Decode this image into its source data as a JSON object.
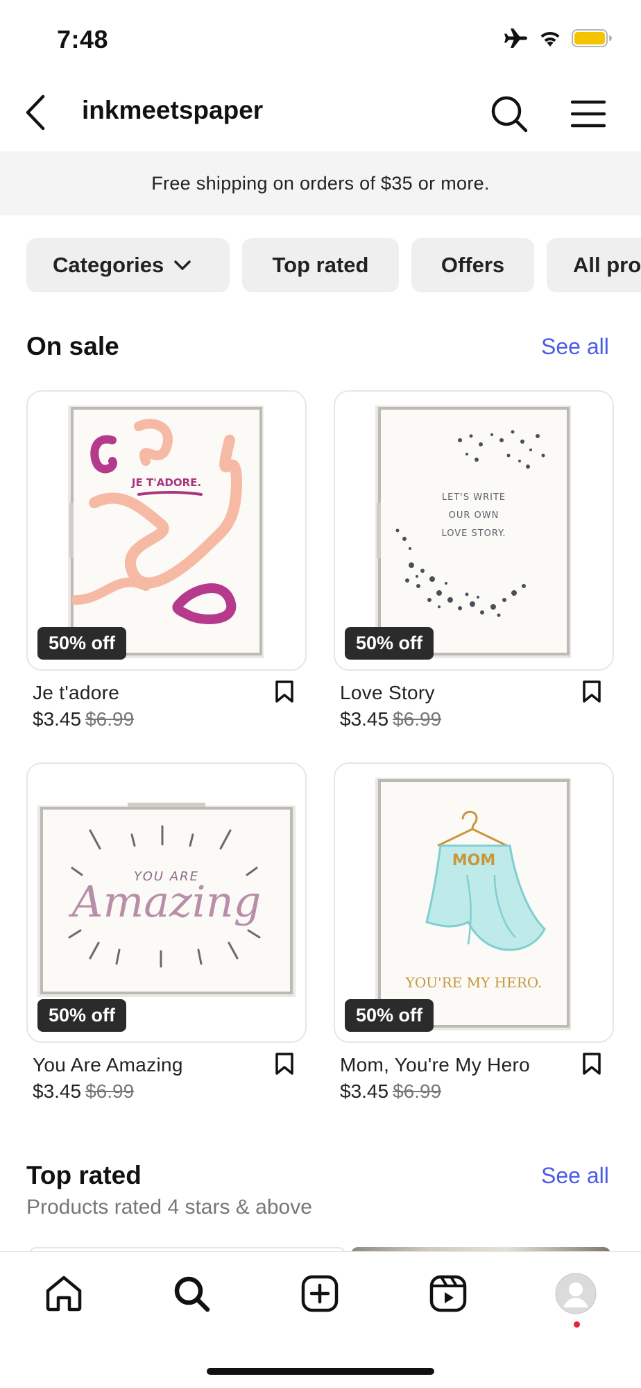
{
  "status_bar": {
    "time": "7:48"
  },
  "header": {
    "title": "inkmeetspaper"
  },
  "banner": {
    "text": "Free shipping on orders of $35 or more."
  },
  "chips": [
    {
      "label": "Categories"
    },
    {
      "label": "Top rated"
    },
    {
      "label": "Offers"
    },
    {
      "label": "All products"
    }
  ],
  "on_sale": {
    "title": "On sale",
    "see_all": "See all",
    "products": [
      {
        "name": "Je t'adore",
        "price": "$3.45",
        "old_price": "$6.99",
        "badge": "50% off",
        "card_text": "JE T'ADORE."
      },
      {
        "name": "Love Story",
        "price": "$3.45",
        "old_price": "$6.99",
        "badge": "50% off",
        "card_text_1": "LET'S WRITE",
        "card_text_2": "OUR OWN",
        "card_text_3": "LOVE STORY."
      },
      {
        "name": "You Are Amazing",
        "price": "$3.45",
        "old_price": "$6.99",
        "badge": "50% off",
        "card_text_1": "YOU ARE",
        "card_text_2": "Amazing"
      },
      {
        "name": "Mom, You're My Hero",
        "price": "$3.45",
        "old_price": "$6.99",
        "badge": "50% off",
        "card_text_1": "MOM",
        "card_text_2": "YOU'RE MY HERO."
      }
    ]
  },
  "top_rated": {
    "title": "Top rated",
    "see_all": "See all",
    "subtitle": "Products rated 4 stars & above"
  },
  "colors": {
    "accent": "#4a5be6",
    "badge": "#2b2b2b",
    "notification": "#e8233a"
  }
}
